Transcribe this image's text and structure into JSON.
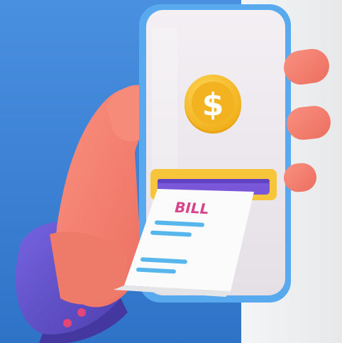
{
  "scene": {
    "description_free": true,
    "colors": {
      "blue_background": "#3f86d8",
      "light_background": "#eceef0",
      "hand": "#f47f6e",
      "hand_shadow": "#e0675a",
      "sleeve": "#6a5bd6",
      "sleeve_dark": "#5346b8",
      "cuff_button": "#e3457a",
      "phone_frame": "#58a9ee",
      "phone_screen": "#ece8ec",
      "coin": "#f6c53a",
      "coin_inner": "#f3b21f",
      "coin_symbol": "#ffffff",
      "slot_top": "#f6c53a",
      "slot_inner": "#7a56d8",
      "receipt": "#fbfbfb",
      "receipt_lines": "#57b6ec",
      "bill_text": "#d6458c"
    }
  },
  "coin": {
    "symbol": "$"
  },
  "receipt": {
    "title": "BILL"
  }
}
